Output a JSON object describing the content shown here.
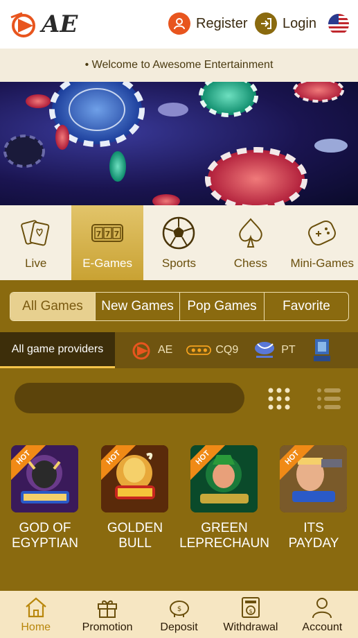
{
  "header": {
    "logo_text": "AE",
    "register_label": "Register",
    "login_label": "Login"
  },
  "marquee": {
    "text": "• Welcome to Awesome Entertainment"
  },
  "categories": [
    {
      "label": "Live",
      "icon": "cards-icon"
    },
    {
      "label": "E-Games",
      "icon": "slot-777-icon"
    },
    {
      "label": "Sports",
      "icon": "soccer-ball-icon"
    },
    {
      "label": "Chess",
      "icon": "spade-icon"
    },
    {
      "label": "Mini-Games",
      "icon": "gamepad-icon"
    }
  ],
  "game_tabs": [
    "All Games",
    "New Games",
    "Pop Games",
    "Favorite"
  ],
  "providers": {
    "all_label": "All game providers",
    "items": [
      {
        "label": "AE",
        "icon": "ae-logo-icon"
      },
      {
        "label": "CQ9",
        "icon": "cq9-logo-icon"
      },
      {
        "label": "PT",
        "icon": "playtech-logo-icon"
      }
    ]
  },
  "games": [
    {
      "name_line1": "GOD OF",
      "name_line2": "EGYPTIAN",
      "badge": "HOT"
    },
    {
      "name_line1": "GOLDEN",
      "name_line2": "BULL",
      "badge": "HOT"
    },
    {
      "name_line1": "GREEN",
      "name_line2": "LEPRECHAUN",
      "badge": "HOT"
    },
    {
      "name_line1": "ITS",
      "name_line2": "PAYDAY",
      "badge": "HOT"
    }
  ],
  "bottom_nav": [
    {
      "label": "Home",
      "icon": "home-icon"
    },
    {
      "label": "Promotion",
      "icon": "gift-icon"
    },
    {
      "label": "Deposit",
      "icon": "piggy-bank-icon"
    },
    {
      "label": "Withdrawal",
      "icon": "atm-icon"
    },
    {
      "label": "Account",
      "icon": "user-icon"
    }
  ],
  "colors": {
    "brand": "#c9a233",
    "background": "#8a6a0f",
    "accent": "#e8551e"
  }
}
